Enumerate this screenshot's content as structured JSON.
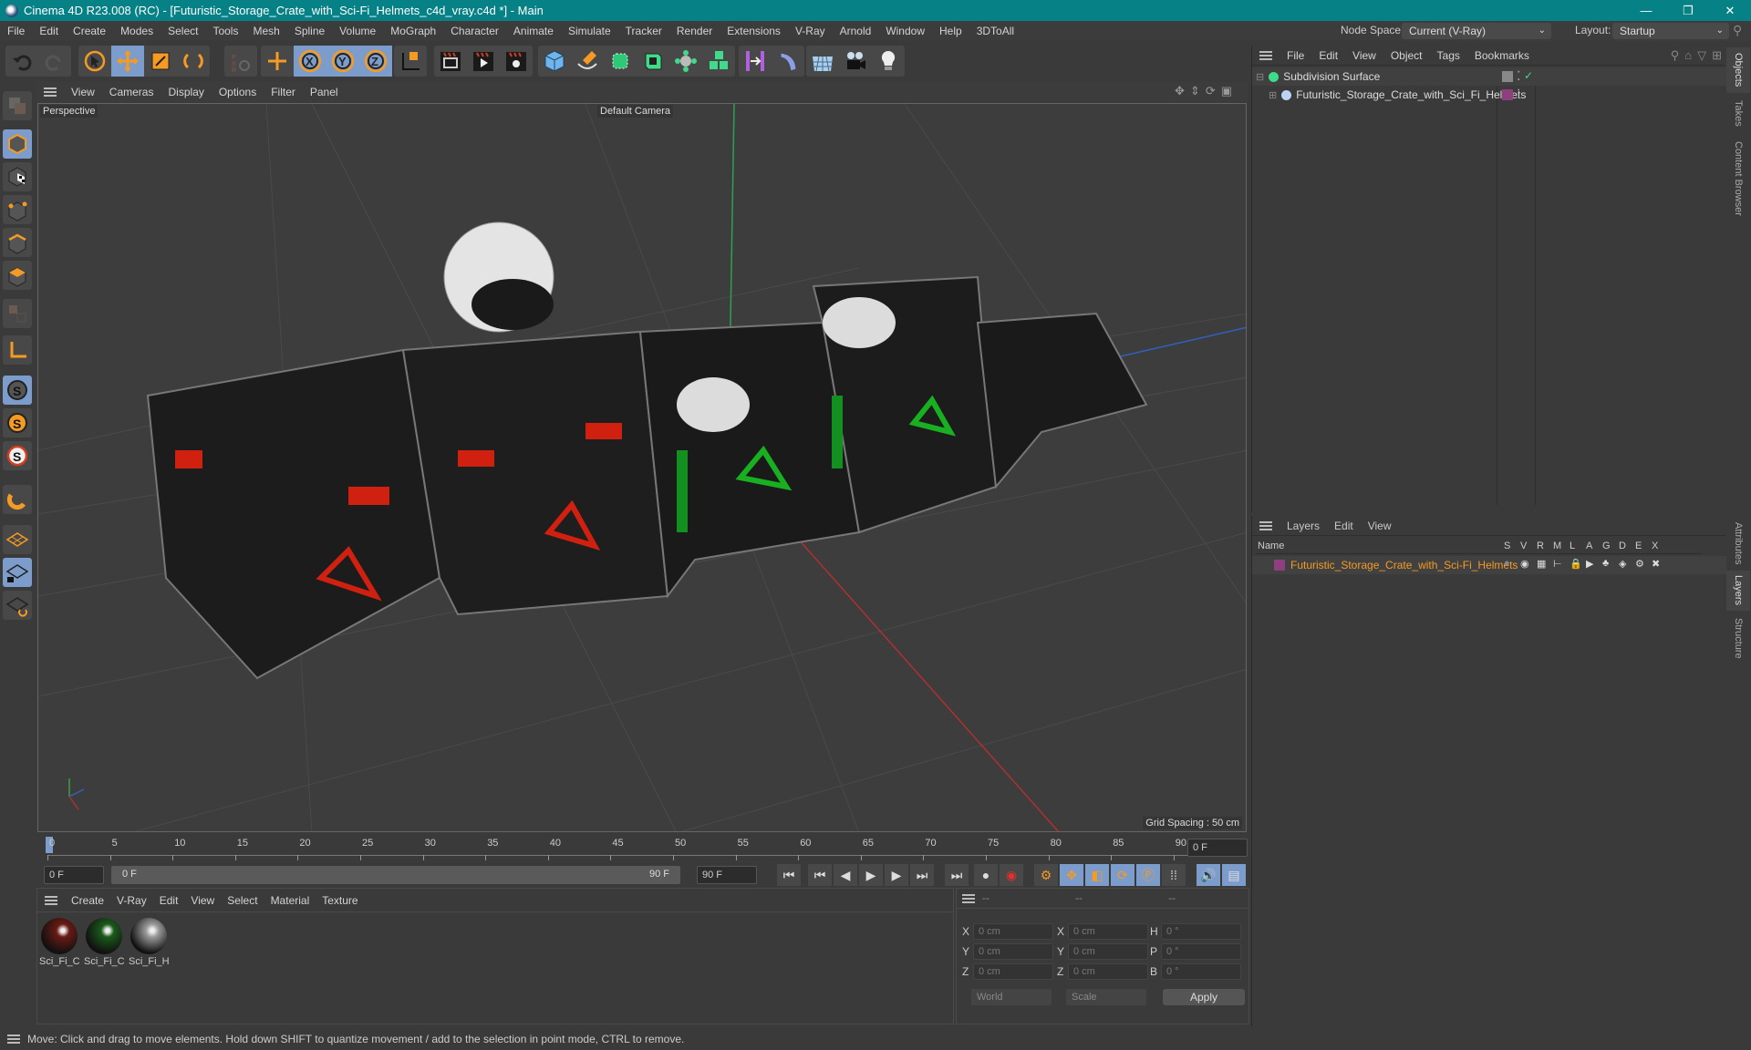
{
  "titlebar": {
    "title": "Cinema 4D R23.008 (RC) - [Futuristic_Storage_Crate_with_Sci-Fi_Helmets_c4d_vray.c4d *] - Main",
    "minimize": "—",
    "restore": "❐",
    "close": "✕"
  },
  "menubar": {
    "items": [
      "File",
      "Edit",
      "Create",
      "Modes",
      "Select",
      "Tools",
      "Mesh",
      "Spline",
      "Volume",
      "MoGraph",
      "Character",
      "Animate",
      "Simulate",
      "Tracker",
      "Render",
      "Extensions",
      "V-Ray",
      "Arnold",
      "Window",
      "Help",
      "3DToAll"
    ],
    "node_space_label": "Node Space:",
    "node_space_value": "Current (V-Ray)",
    "layout_label": "Layout:",
    "layout_value": "Startup"
  },
  "toolbar": {
    "icons": [
      "undo-icon",
      "redo-icon",
      "select-icon",
      "move-icon",
      "scale-icon",
      "rotate-icon",
      "psr-icon",
      "add-axis-icon",
      "x-axis-icon",
      "y-axis-icon",
      "z-axis-icon",
      "coordinate-system-icon",
      "render-view-icon",
      "render-icon",
      "render-settings-icon",
      "cube-icon",
      "pen-icon",
      "subdivision-icon",
      "extrude-icon",
      "array-icon",
      "cloner-icon",
      "symmetry-icon",
      "deformer-icon",
      "floor-icon",
      "camera-icon",
      "light-icon"
    ]
  },
  "viewport": {
    "menu": [
      "View",
      "Cameras",
      "Display",
      "Options",
      "Filter",
      "Panel"
    ],
    "view_name": "Perspective",
    "camera": "Default Camera",
    "grid_spacing": "Grid Spacing : 50 cm"
  },
  "timeline": {
    "ticks": [
      "0",
      "5",
      "10",
      "15",
      "20",
      "25",
      "30",
      "35",
      "40",
      "45",
      "50",
      "55",
      "60",
      "65",
      "70",
      "75",
      "80",
      "85",
      "90"
    ],
    "current_frame": "0 F",
    "start_field": "0 F",
    "range_start": "0 F",
    "range_end": "90 F",
    "end_field": "90 F"
  },
  "materials": {
    "menu": [
      "Create",
      "V-Ray",
      "Edit",
      "View",
      "Select",
      "Material",
      "Texture"
    ],
    "items": [
      {
        "name": "Sci_Fi_Cc",
        "tint": "#6a1a14"
      },
      {
        "name": "Sci_Fi_Cc",
        "tint": "#1a5a1a"
      },
      {
        "name": "Sci_Fi_He",
        "tint": "#9a9a9a"
      }
    ]
  },
  "coords": {
    "headers": [
      "--",
      "--",
      "--"
    ],
    "rows": [
      {
        "l1": "X",
        "v1": "0 cm",
        "l2": "X",
        "v2": "0 cm",
        "l3": "H",
        "v3": "0 °"
      },
      {
        "l1": "Y",
        "v1": "0 cm",
        "l2": "Y",
        "v2": "0 cm",
        "l3": "P",
        "v3": "0 °"
      },
      {
        "l1": "Z",
        "v1": "0 cm",
        "l2": "Z",
        "v2": "0 cm",
        "l3": "B",
        "v3": "0 °"
      }
    ],
    "space": "World",
    "mode": "Scale",
    "apply": "Apply"
  },
  "objects": {
    "menu": [
      "File",
      "Edit",
      "View",
      "Object",
      "Tags",
      "Bookmarks"
    ],
    "items": [
      {
        "name": "Subdivision Surface"
      },
      {
        "name": "Futuristic_Storage_Crate_with_Sci_Fi_Helmets",
        "color": "#8e3f7e"
      }
    ]
  },
  "layers": {
    "menu": [
      "Layers",
      "Edit",
      "View"
    ],
    "columns": [
      "Name",
      "S",
      "V",
      "R",
      "M",
      "L",
      "A",
      "G",
      "D",
      "E",
      "X"
    ],
    "items": [
      {
        "name": "Futuristic_Storage_Crate_with_Sci-Fi_Helmets",
        "color": "#8e3f7e"
      }
    ]
  },
  "side_tabs": {
    "top": [
      "Objects",
      "Takes",
      "Content Browser"
    ],
    "bottom": [
      "Attributes",
      "Layers",
      "Structure"
    ]
  },
  "status": {
    "text": "Move: Click and drag to move elements. Hold down SHIFT to quantize movement / add to the selection in point mode, CTRL to remove."
  },
  "colors": {
    "accent": "#f59a23",
    "titlebar": "#068287",
    "selected": "#7c9ccc",
    "layer_text": "#f59a23"
  }
}
